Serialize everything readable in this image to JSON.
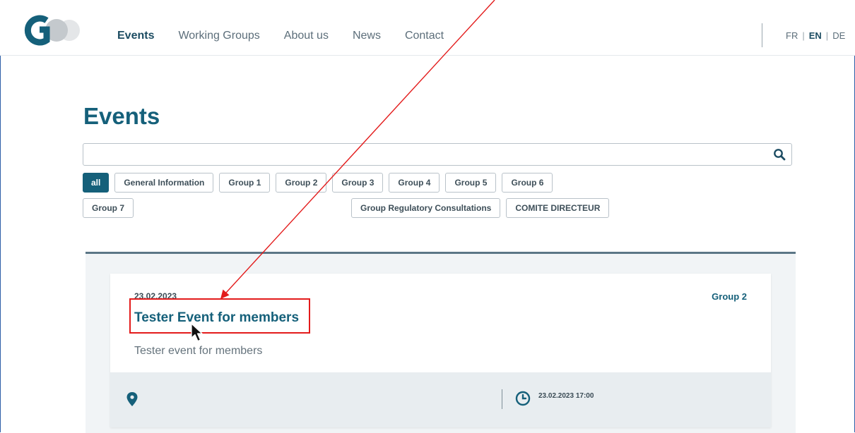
{
  "header": {
    "nav": [
      "Events",
      "Working Groups",
      "About us",
      "News",
      "Contact"
    ],
    "languages": [
      "FR",
      "EN",
      "DE"
    ]
  },
  "page": {
    "title": "Events"
  },
  "search": {
    "value": "",
    "placeholder": ""
  },
  "filters": [
    "all",
    "General Information",
    "Group 1",
    "Group 2",
    "Group 3",
    "Group 4",
    "Group 5",
    "Group 6",
    "Group 7",
    "Group Regulatory Consultations",
    "COMITE DIRECTEUR"
  ],
  "event": {
    "date": "23.02.2023",
    "group": "Group 2",
    "title": "Tester Event for members",
    "description": "Tester event for members",
    "location": "",
    "datetime": "23.02.2023 17:00"
  },
  "colors": {
    "primary": "#15607a",
    "annotation": "#e31b1b"
  }
}
